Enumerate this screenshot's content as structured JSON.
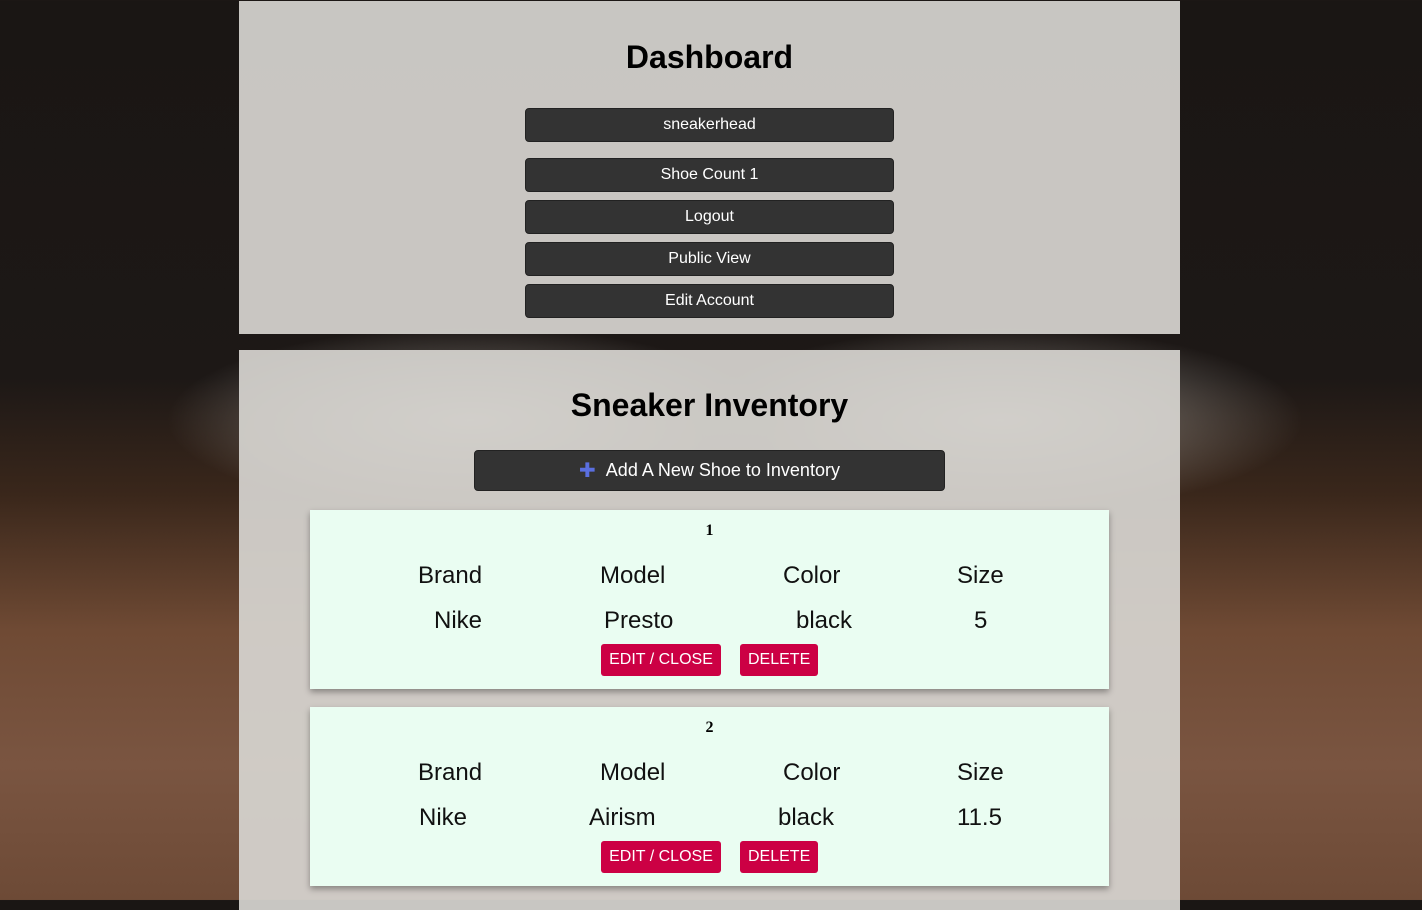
{
  "dashboard": {
    "title": "Dashboard",
    "username": "sneakerhead",
    "shoe_count": "Shoe Count 1",
    "logout": "Logout",
    "public_view": "Public View",
    "edit_account": "Edit Account"
  },
  "inventory": {
    "title": "Sneaker Inventory",
    "add_icon": "plus-icon",
    "add_label": "Add A New Shoe to Inventory",
    "headers": {
      "brand": "Brand",
      "model": "Model",
      "color": "Color",
      "size": "Size"
    },
    "edit_label": "EDIT / CLOSE",
    "delete_label": "DELETE",
    "shoes": [
      {
        "num": "1",
        "brand": "Nike",
        "model": "Presto",
        "color": "black",
        "size": "5"
      },
      {
        "num": "2",
        "brand": "Nike",
        "model": "Airism",
        "color": "black",
        "size": "11.5"
      }
    ]
  },
  "colors": {
    "button_dark": "#333333",
    "card_bg": "#eafdf2",
    "danger": "#cc0044",
    "accent_plus": "#5a6fe0"
  }
}
